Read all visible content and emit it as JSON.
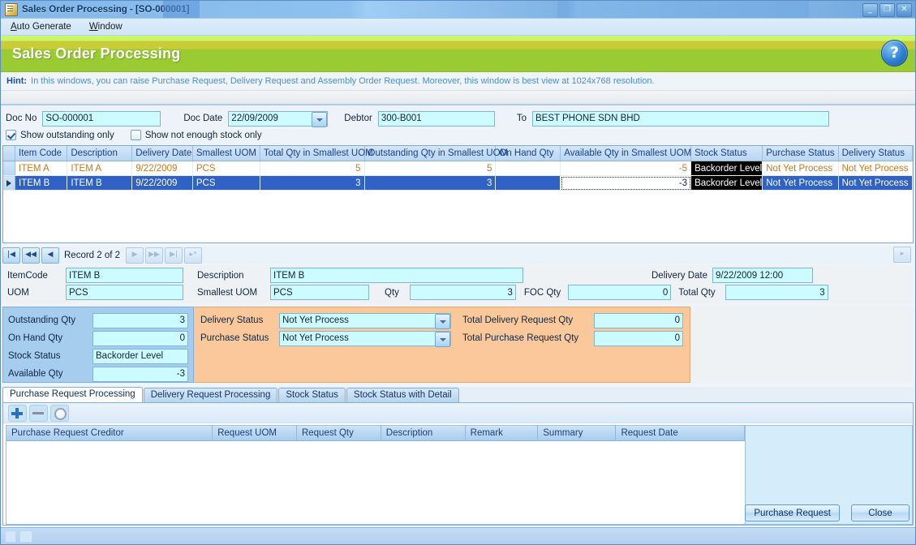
{
  "window": {
    "title": "Sales Order Processing - [SO-000001]",
    "icon": "document-icon",
    "controls": [
      {
        "name": "minimize-button",
        "glyph": "_"
      },
      {
        "name": "restore-button",
        "glyph": "❐"
      },
      {
        "name": "close-button",
        "glyph": "✕"
      }
    ]
  },
  "menubar": {
    "items": [
      {
        "name": "menu-auto-generate",
        "label": "Auto Generate",
        "accel": "A"
      },
      {
        "name": "menu-window",
        "label": "Window",
        "accel": "W"
      }
    ]
  },
  "banner": {
    "title": "Sales Order Processing",
    "help_icon": "help-question-icon",
    "colors": {
      "top": "#cdf56a",
      "mid": "#c9cb37",
      "main": "#9acb33"
    }
  },
  "hint": {
    "label": "Hint:",
    "text": "In this windows, you can raise Purchase Request, Delivery Request and Assembly Order Request. Moreover, this window is best view at 1024x768 resolution."
  },
  "filters": {
    "doc_no_label": "Doc No",
    "doc_no_value": "SO-000001",
    "doc_date_label": "Doc Date",
    "doc_date_value": "22/09/2009",
    "debtor_label": "Debtor",
    "debtor_value": "300-B001",
    "to_label": "To",
    "to_value": "BEST PHONE SDN BHD",
    "checkboxes": [
      {
        "name": "checkbox-show-outstanding-only",
        "label": "Show outstanding only",
        "checked": true
      },
      {
        "name": "checkbox-show-not-enough-stock-only",
        "label": "Show not enough stock only",
        "checked": false
      }
    ]
  },
  "grid": {
    "columns": [
      "Item Code",
      "Description",
      "Delivery Date",
      "Smallest UOM",
      "Total Qty in Smallest UOM",
      "Outstanding Qty in Smallest UOM",
      "On Hand Qty",
      "Available Qty in Smallest UOM",
      "Stock Status",
      "Purchase Status",
      "Delivery Status"
    ],
    "rows": [
      {
        "selected": false,
        "item_code": "ITEM A",
        "description": "ITEM A",
        "delivery_date": "9/22/2009",
        "smallest_uom": "PCS",
        "total_qty": "5",
        "outstanding_qty": "5",
        "on_hand_qty": "",
        "available_qty": "-5",
        "stock_status": "Backorder Level",
        "purchase_status": "Not Yet Process",
        "delivery_status": "Not Yet Process"
      },
      {
        "selected": true,
        "item_code": "ITEM B",
        "description": "ITEM B",
        "delivery_date": "9/22/2009",
        "smallest_uom": "PCS",
        "total_qty": "3",
        "outstanding_qty": "3",
        "on_hand_qty": "",
        "available_qty": "-3",
        "stock_status": "Backorder Level",
        "purchase_status": "Not Yet Process",
        "delivery_status": "Not Yet Process"
      }
    ]
  },
  "record_nav": {
    "label": "Record 2 of 2",
    "buttons": [
      {
        "name": "nav-first-button",
        "glyph": "|◀",
        "enabled": true
      },
      {
        "name": "nav-prev-page-button",
        "glyph": "◀◀",
        "enabled": true
      },
      {
        "name": "nav-prev-button",
        "glyph": "◀",
        "enabled": true
      },
      {
        "name": "nav-next-button",
        "glyph": "▶",
        "enabled": false
      },
      {
        "name": "nav-next-page-button",
        "glyph": "▶▶",
        "enabled": false
      },
      {
        "name": "nav-last-button",
        "glyph": "▶|",
        "enabled": false
      },
      {
        "name": "nav-new-button",
        "glyph": "▶*",
        "enabled": false
      }
    ],
    "right_button": {
      "name": "nav-expand-button",
      "glyph": "▸"
    }
  },
  "detail": {
    "item_code_label": "ItemCode",
    "item_code_value": "ITEM B",
    "description_label": "Description",
    "description_value": "ITEM B",
    "delivery_date_label": "Delivery Date",
    "delivery_date_value": "9/22/2009 12:00",
    "uom_label": "UOM",
    "uom_value": "PCS",
    "smallest_uom_label": "Smallest UOM",
    "smallest_uom_value": "PCS",
    "qty_label": "Qty",
    "qty_value": "3",
    "foc_qty_label": "FOC Qty",
    "foc_qty_value": "0",
    "total_qty_label": "Total Qty",
    "total_qty_value": "3"
  },
  "stock_panel": {
    "outstanding_qty_label": "Outstanding Qty",
    "outstanding_qty_value": "3",
    "on_hand_qty_label": "On Hand Qty",
    "on_hand_qty_value": "0",
    "stock_status_label": "Stock Status",
    "stock_status_value": "Backorder Level",
    "available_qty_label": "Available Qty",
    "available_qty_value": "-3"
  },
  "status_panel": {
    "delivery_status_label": "Delivery Status",
    "delivery_status_value": "Not Yet Process",
    "purchase_status_label": "Purchase Status",
    "purchase_status_value": "Not Yet Process",
    "total_delivery_request_label": "Total Delivery Request Qty",
    "total_delivery_request_value": "0",
    "total_purchase_request_label": "Total Purchase Request Qty",
    "total_purchase_request_value": "0"
  },
  "tabs": [
    {
      "name": "tab-purchase-request-processing",
      "label": "Purchase Request Processing",
      "active": true
    },
    {
      "name": "tab-delivery-request-processing",
      "label": "Delivery Request Processing",
      "active": false
    },
    {
      "name": "tab-stock-status",
      "label": "Stock Status",
      "active": false
    },
    {
      "name": "tab-stock-status-with-detail",
      "label": "Stock Status with Detail",
      "active": false
    }
  ],
  "mini_toolbar": [
    {
      "name": "add-row-button",
      "icon": "plus-icon"
    },
    {
      "name": "remove-row-button",
      "icon": "minus-icon"
    },
    {
      "name": "lookup-button",
      "icon": "magnifier-icon"
    }
  ],
  "sub_grid": {
    "columns": [
      "Purchase Request Creditor",
      "Request UOM",
      "Request Qty",
      "Description",
      "Remark",
      "Summary",
      "Request Date"
    ],
    "rows": []
  },
  "buttons": {
    "purchase_request": "Purchase Request",
    "close": "Close"
  }
}
